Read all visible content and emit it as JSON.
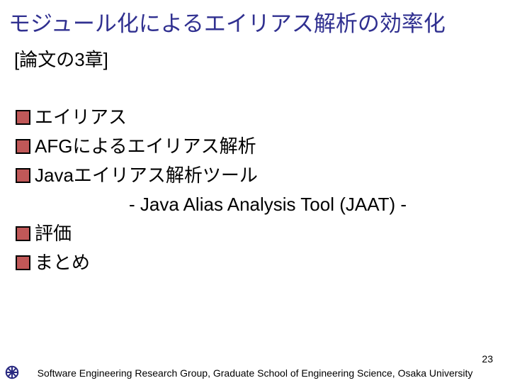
{
  "title": "モジュール化によるエイリアス解析の効率化",
  "subtitle": "[論文の3章]",
  "bullets": {
    "b1": "エイリアス",
    "b2": "AFGによるエイリアス解析",
    "b3": "Javaエイリアス解析ツール",
    "sub3": "- Java Alias Analysis Tool (JAAT) -",
    "b4": "評価",
    "b5": "まとめ"
  },
  "page_number": "23",
  "footer": "Software Engineering Research Group, Graduate School of Engineering Science, Osaka University"
}
